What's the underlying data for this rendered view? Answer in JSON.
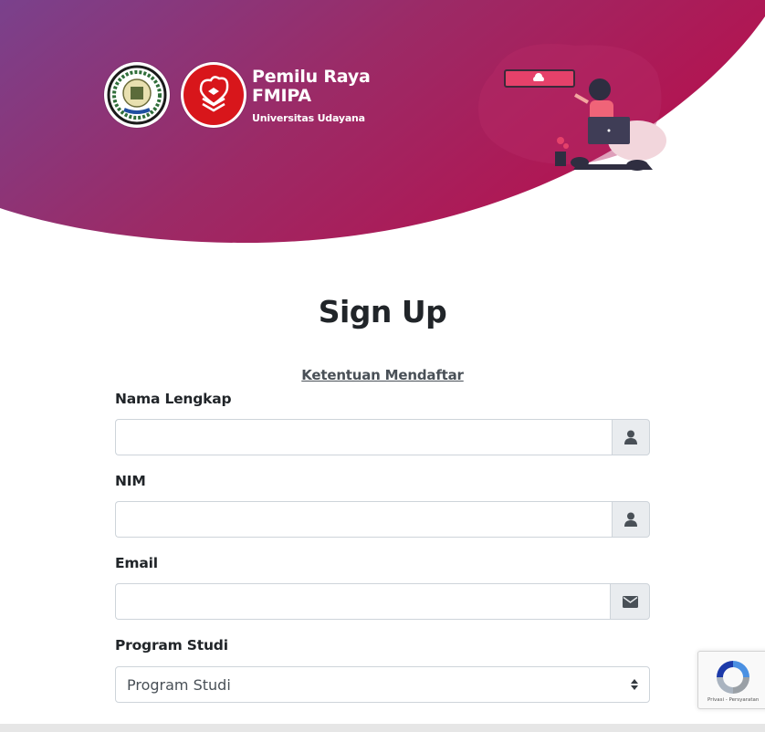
{
  "header": {
    "brand_title_line1": "Pemilu Raya",
    "brand_title_line2": "FMIPA",
    "brand_subtitle": "Universitas Udayana",
    "gradient_colors": [
      "#7b3f8c",
      "#a0275f",
      "#b31552"
    ]
  },
  "form": {
    "title": "Sign Up",
    "terms_link": "Ketentuan Mendaftar",
    "fields": [
      {
        "label": "Nama Lengkap",
        "value": "",
        "icon": "user-icon"
      },
      {
        "label": "NIM",
        "value": "",
        "icon": "user-icon"
      },
      {
        "label": "Email",
        "value": "",
        "icon": "envelope-icon"
      }
    ],
    "program_studi": {
      "label": "Program Studi",
      "selected": "Program Studi"
    }
  },
  "recaptcha": {
    "terms": "Privasi - Persyaratan"
  }
}
